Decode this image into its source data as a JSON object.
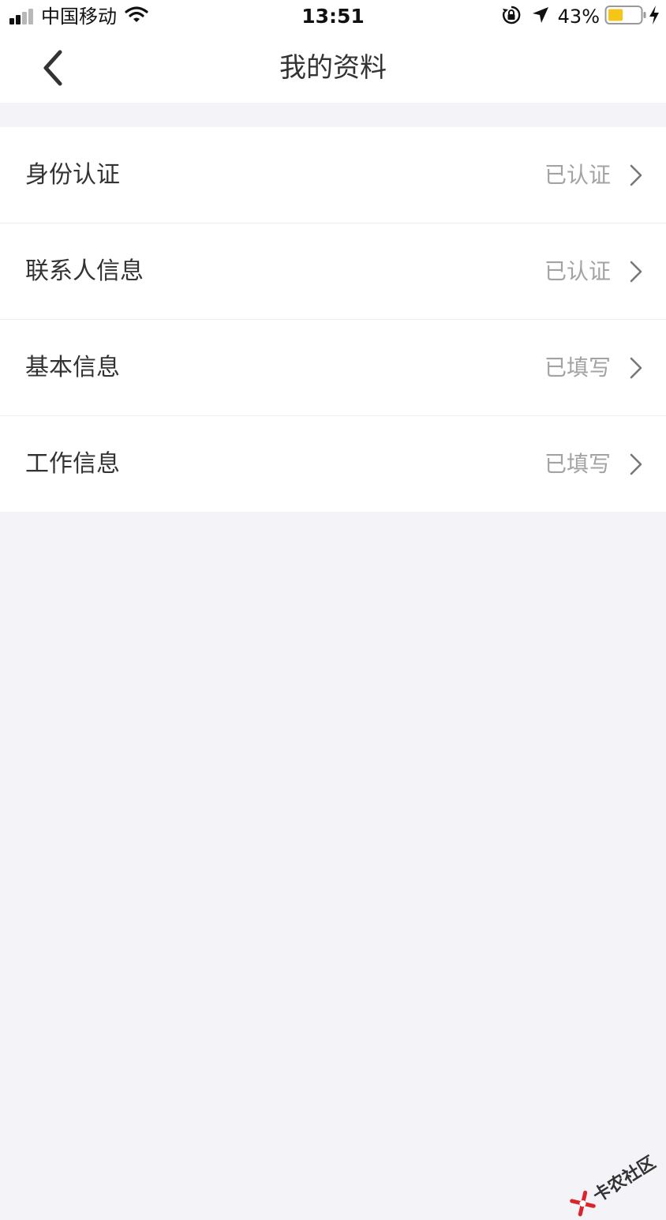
{
  "status_bar": {
    "carrier": "中国移动",
    "time": "13:51",
    "battery": "43%"
  },
  "nav": {
    "title": "我的资料"
  },
  "items": [
    {
      "label": "身份认证",
      "status": "已认证"
    },
    {
      "label": "联系人信息",
      "status": "已认证"
    },
    {
      "label": "基本信息",
      "status": "已填写"
    },
    {
      "label": "工作信息",
      "status": "已填写"
    }
  ],
  "watermark": {
    "text": "卡农社区"
  },
  "colors": {
    "battery_fill": "#f5c518",
    "background": "#f3f3f8",
    "status_text": "#a3a3a3"
  },
  "icons": [
    "signal-icon",
    "wifi-icon",
    "rotation-lock-icon",
    "location-arrow-icon",
    "battery-icon",
    "charging-bolt-icon",
    "back-arrow-icon",
    "chevron-right-icon"
  ]
}
